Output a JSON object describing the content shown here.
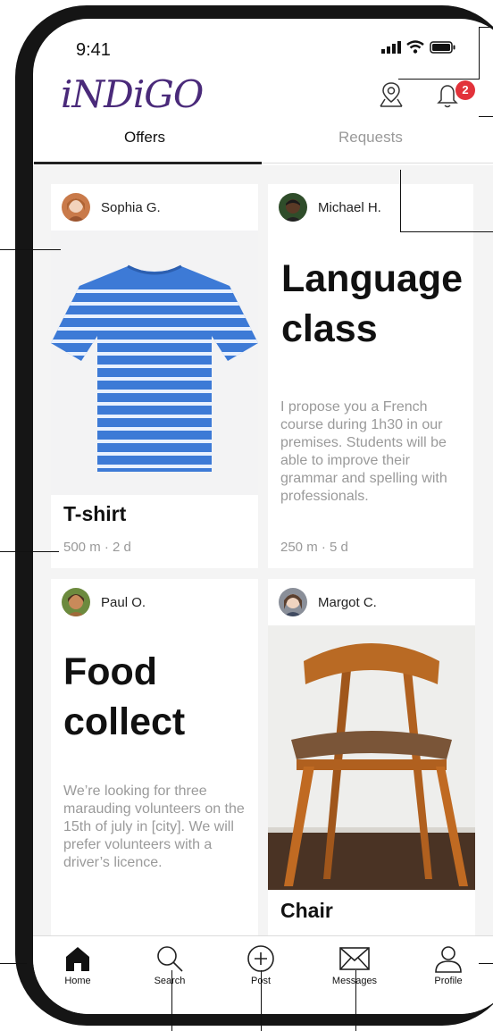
{
  "status": {
    "time": "9:41"
  },
  "header": {
    "logo": "iNDiGO",
    "notification_count": "2"
  },
  "tabs": [
    {
      "label": "Offers"
    },
    {
      "label": "Requests"
    }
  ],
  "cards": [
    {
      "user": "Sophia G.",
      "title": "T-shirt",
      "meta": "500 m · 2 d"
    },
    {
      "user": "Michael H.",
      "title": "Language class",
      "description": "I propose you a French course during 1h30 in our premises. Students will be able to improve their grammar and spelling with professionals.",
      "meta": "250 m · 5 d"
    },
    {
      "user": "Paul O.",
      "title": "Food collect",
      "description": "We’re looking for three marauding volunteers on the 15th of july in [city]. We will prefer volunteers with a driver’s licence."
    },
    {
      "user": "Margot C.",
      "title": "Chair"
    }
  ],
  "nav": [
    {
      "label": "Home",
      "icon": "home-icon"
    },
    {
      "label": "Search",
      "icon": "search-icon"
    },
    {
      "label": "Post",
      "icon": "plus-circle-icon"
    },
    {
      "label": "Messages",
      "icon": "envelope-icon"
    },
    {
      "label": "Profile",
      "icon": "user-icon"
    }
  ],
  "colors": {
    "accent": "#4a2a7a",
    "badge": "#e2323a",
    "shirt": "#3d7ad6",
    "chair": "#b0601f"
  }
}
